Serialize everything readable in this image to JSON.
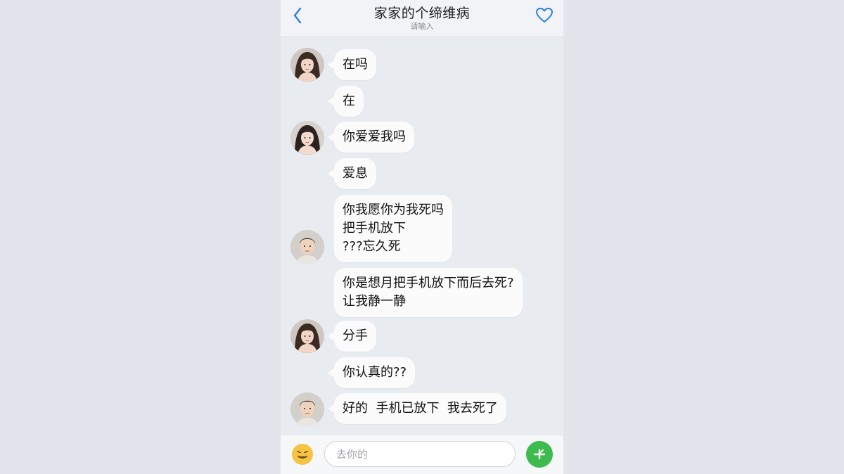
{
  "header": {
    "title": "家家的个缔维病",
    "subtitle": "请输入",
    "back_icon": "chevron-left-icon",
    "favorite_icon": "heart-icon"
  },
  "messages": [
    {
      "lines": [
        "在吗"
      ],
      "avatar": "female"
    },
    {
      "lines": [
        "在"
      ],
      "avatar": null
    },
    {
      "lines": [
        "你爱爱我吗"
      ],
      "avatar": "female"
    },
    {
      "lines": [
        "爱息"
      ],
      "avatar": null
    },
    {
      "lines": [
        "你我愿你为我死吗",
        "把手机放下",
        "???忘久死"
      ],
      "avatar": "male"
    },
    {
      "lines": [
        "你是想月把手机放下而后去死?",
        "让我静一静"
      ],
      "avatar": null
    },
    {
      "lines": [
        "分手"
      ],
      "avatar": "female"
    },
    {
      "lines": [
        "你认真的??"
      ],
      "avatar": null
    },
    {
      "lines": [
        "好的  手机已放下  我去死了"
      ],
      "avatar": "male"
    }
  ],
  "input": {
    "placeholder": "去你的",
    "value": "",
    "emoji_icon": "emoji-icon",
    "send_icon": "send-icon"
  },
  "colors": {
    "accent": "#2f7fe0",
    "send": "#3dbb4f",
    "bubble": "#fbfbfc",
    "background": "#e2e6ec"
  }
}
